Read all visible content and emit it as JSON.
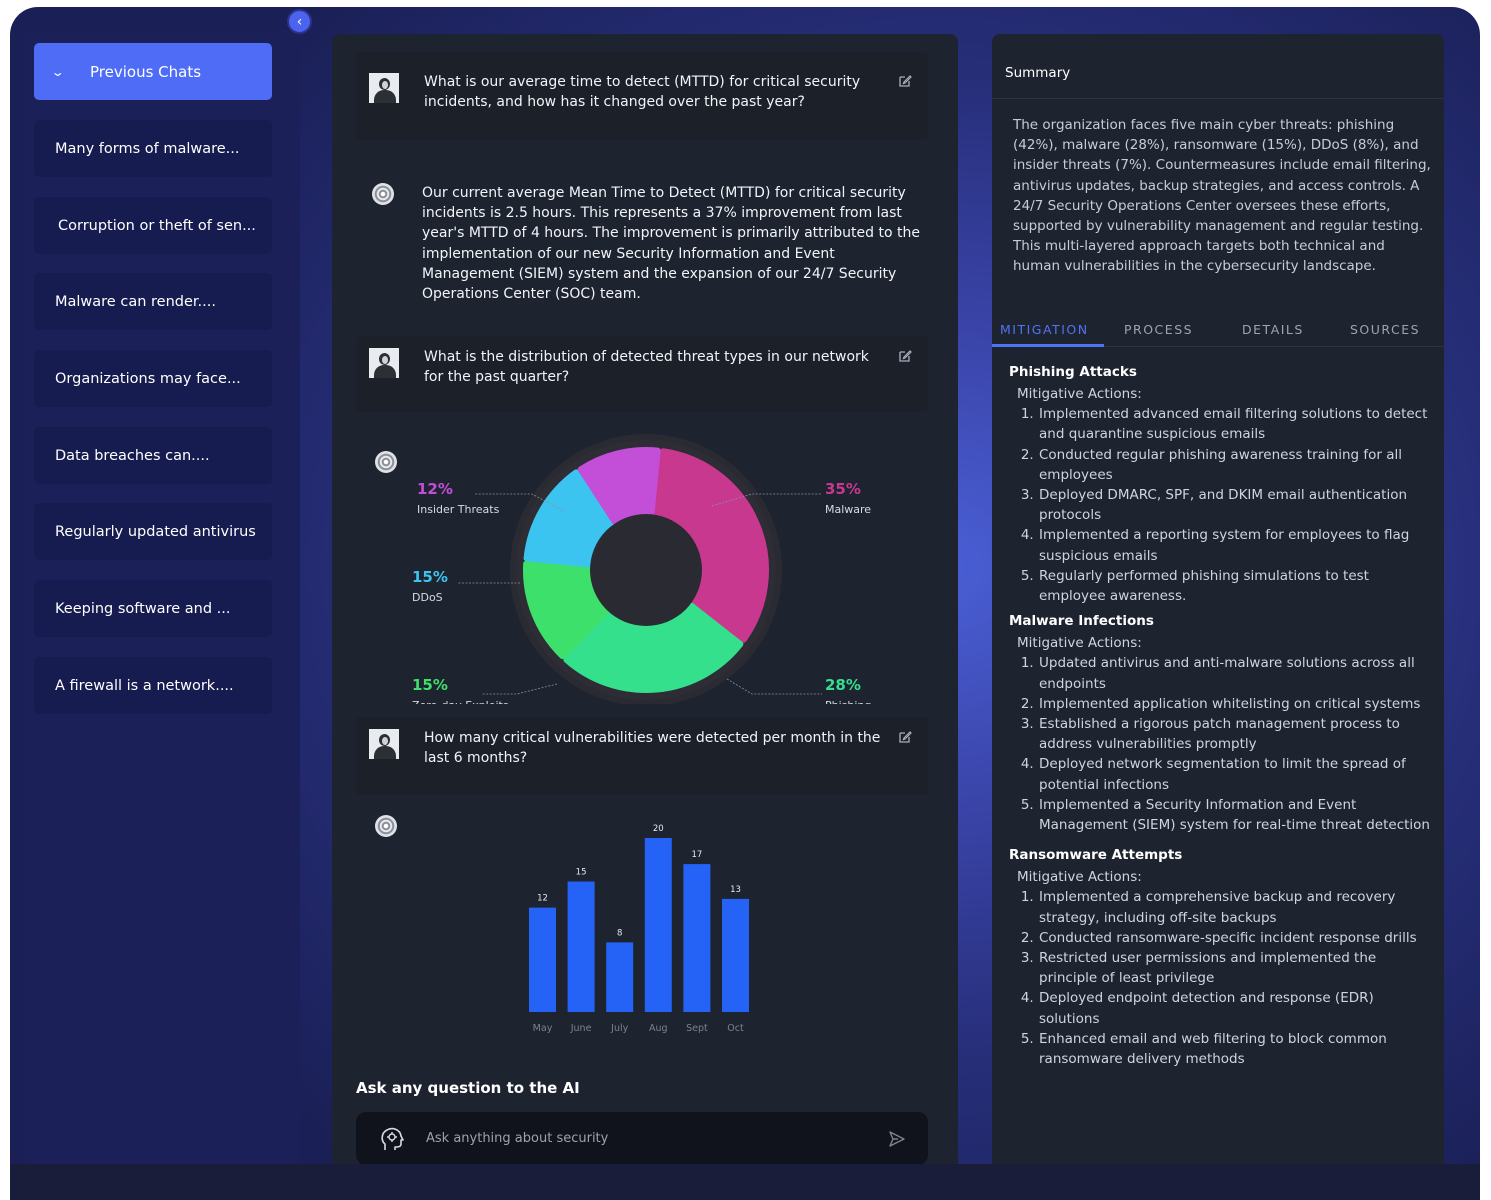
{
  "sidebar": {
    "header_label": "Previous Chats",
    "items": [
      {
        "label": "Many forms of malware..."
      },
      {
        "label": "Corruption or theft of sen..."
      },
      {
        "label": "Malware can render...."
      },
      {
        "label": "Organizations may face..."
      },
      {
        "label": "Data breaches can...."
      },
      {
        "label": "Regularly updated antivirus"
      },
      {
        "label": "Keeping software and ..."
      },
      {
        "label": "A firewall is a network...."
      }
    ]
  },
  "conversation": {
    "q1": "What is our average time to detect (MTTD) for critical security incidents, and how has it changed over the past year?",
    "a1": "Our current average Mean Time to Detect (MTTD) for critical security incidents is 2.5 hours. This represents a 37% improvement from last year's MTTD of 4 hours. The improvement is primarily attributed to the implementation of our new Security Information and Event Management (SIEM) system and the expansion of our 24/7 Security Operations Center (SOC) team.",
    "q2": "What is the distribution of detected threat types in our network for the past quarter?",
    "q3": "How many critical vulnerabilities were detected per month in the last 6 months?"
  },
  "chart_data": [
    {
      "type": "pie",
      "categories": [
        "Malware",
        "Phishing",
        "Zero-day Exploits",
        "DDoS",
        "Insider Threats"
      ],
      "values": [
        35,
        28,
        15,
        15,
        12
      ],
      "value_labels": [
        "35%",
        "28%",
        "15%",
        "15%",
        "12%"
      ],
      "colors": [
        "#c9388f",
        "#34e08c",
        "#3de06a",
        "#3cc4f0",
        "#c34ed8"
      ]
    },
    {
      "type": "bar",
      "categories": [
        "May",
        "June",
        "July",
        "Aug",
        "Sept",
        "Oct"
      ],
      "values": [
        12,
        15,
        8,
        20,
        17,
        13
      ],
      "ylim": [
        0,
        20
      ],
      "color": "#2463f5"
    }
  ],
  "ask": {
    "label": "Ask any question to the AI",
    "placeholder": "Ask anything about security"
  },
  "summary": {
    "title": "Summary",
    "text": "The organization faces five main cyber threats: phishing (42%), malware (28%), ransomware (15%), DDoS (8%), and insider threats (7%). Countermeasures include email filtering, antivirus updates, backup strategies, and access controls. A 24/7 Security Operations Center oversees these efforts, supported by vulnerability management and regular testing. This multi-layered approach targets both technical and human vulnerabilities in the cybersecurity landscape."
  },
  "tabs": [
    "MITIGATION",
    "PROCESS",
    "DETAILS",
    "SOURCES"
  ],
  "mitigation": {
    "sections": [
      {
        "title": "Phishing Attacks",
        "subtitle": "Mitigative Actions:",
        "items": [
          "Implemented advanced email filtering solutions to detect and quarantine suspicious emails",
          "Conducted regular phishing awareness training for all employees",
          "Deployed DMARC, SPF, and DKIM email authentication protocols",
          "Implemented a reporting system for employees to flag suspicious emails",
          "Regularly performed phishing simulations to test employee awareness."
        ]
      },
      {
        "title": "Malware Infections",
        "subtitle": "Mitigative Actions:",
        "items": [
          "Updated antivirus and anti-malware solutions across all endpoints",
          "Implemented application whitelisting on critical systems",
          "Established a rigorous patch management process to address vulnerabilities promptly",
          "Deployed network segmentation to limit the spread of potential infections",
          "Implemented a Security Information and Event Management (SIEM) system for real-time threat detection"
        ]
      },
      {
        "title": "Ransomware Attempts",
        "subtitle": "Mitigative Actions:",
        "items": [
          "Implemented a comprehensive backup and recovery strategy, including off-site backups",
          "Conducted ransomware-specific incident response drills",
          "Restricted user permissions and implemented the principle of least privilege",
          "Deployed endpoint detection and response (EDR) solutions",
          "Enhanced email and web filtering to block common ransomware delivery methods"
        ]
      }
    ]
  }
}
